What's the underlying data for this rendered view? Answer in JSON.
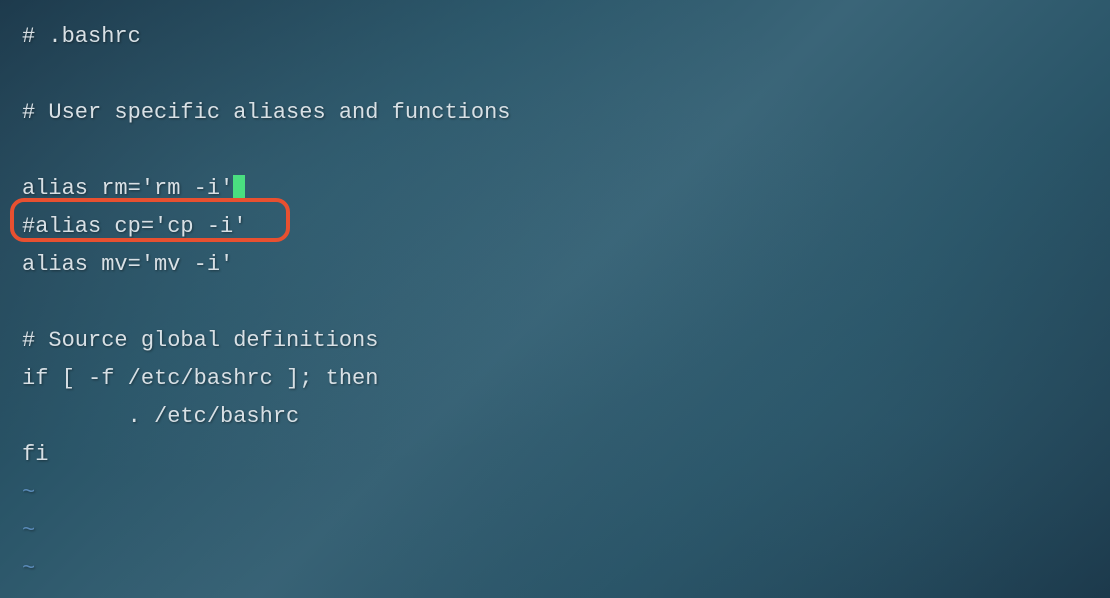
{
  "lines": {
    "l0": "# .bashrc",
    "l1": "",
    "l2": "# User specific aliases and functions",
    "l3": "",
    "l4": "alias rm='rm -i'",
    "l5": "#alias cp='cp -i'",
    "l6": "alias mv='mv -i'",
    "l7": "",
    "l8": "# Source global definitions",
    "l9": "if [ -f /etc/bashrc ]; then",
    "l10": "        . /etc/bashrc",
    "l11": "fi"
  },
  "tilde": "~"
}
